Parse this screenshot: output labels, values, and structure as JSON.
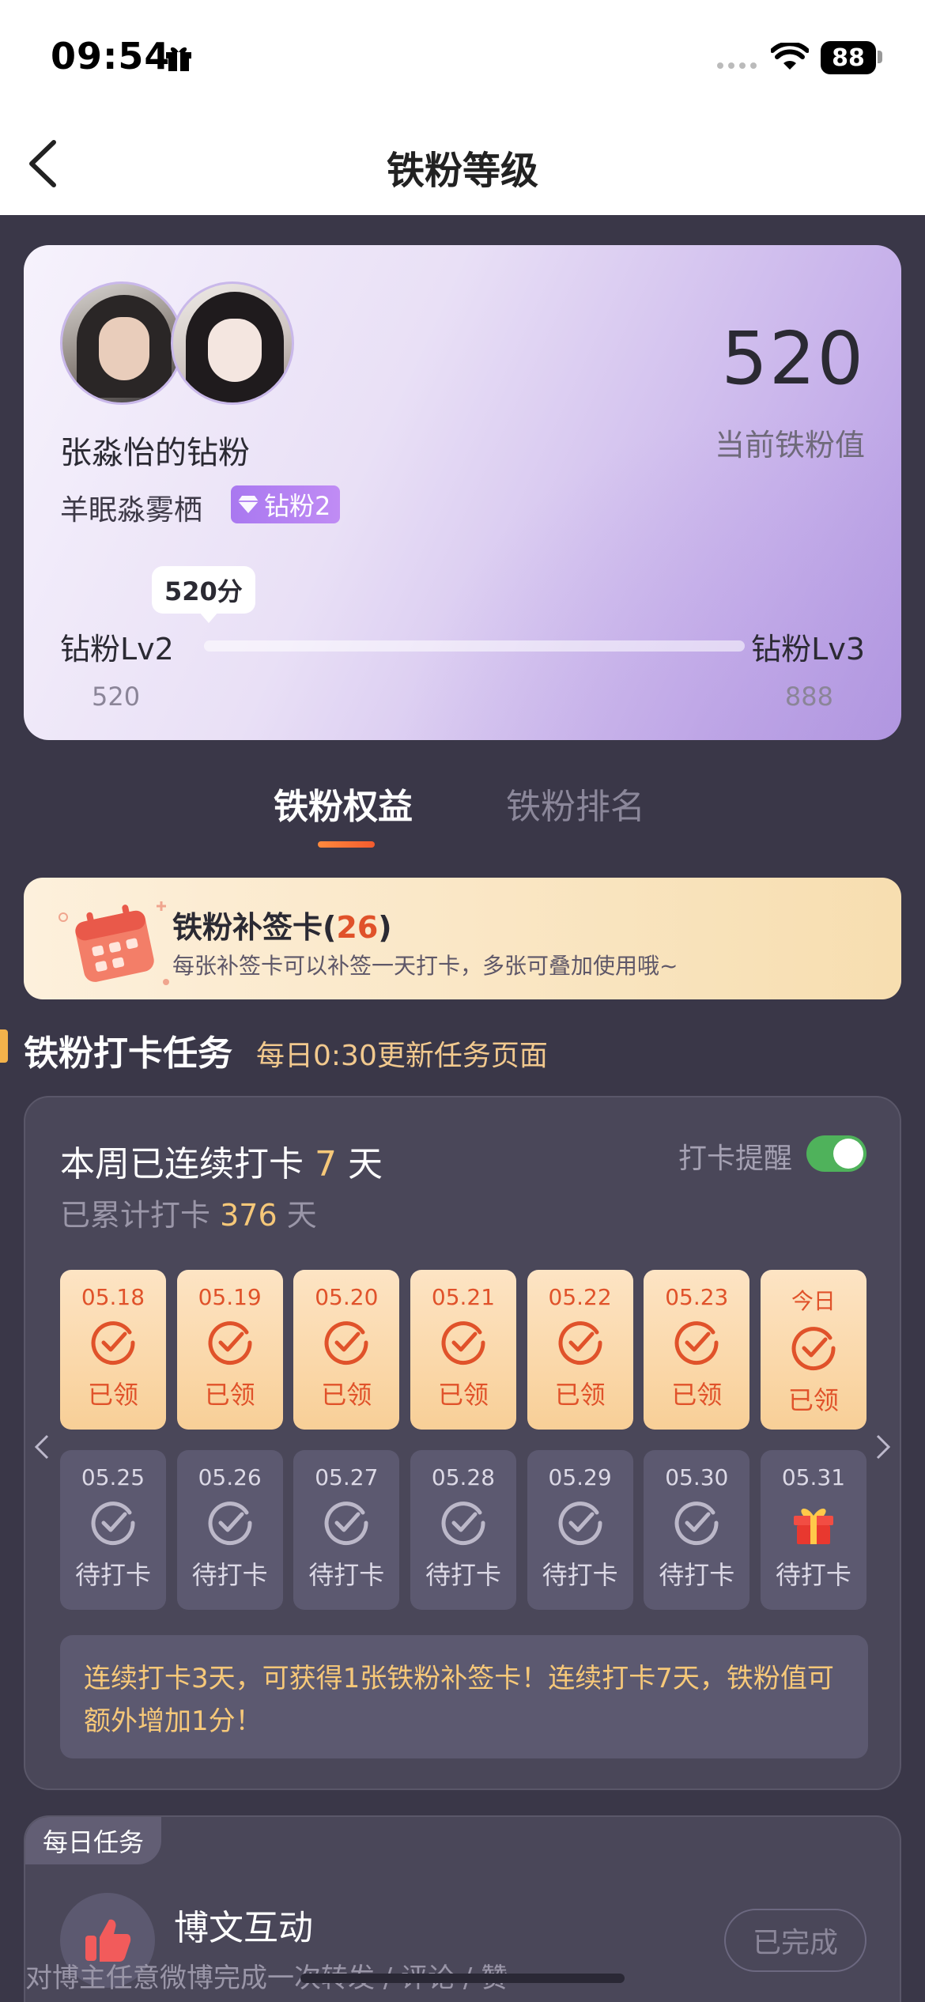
{
  "status_bar": {
    "time": "09:54",
    "battery": "88"
  },
  "nav": {
    "title": "铁粉等级"
  },
  "level_card": {
    "fan_title": "张淼怡的钻粉",
    "owner_name": "羊眠淼雾栖",
    "badge": "钻粉2",
    "score": "520",
    "score_label": "当前铁粉值",
    "bubble": "520分",
    "current_level": "钻粉Lv2",
    "current_level_value": "520",
    "next_level": "钻粉Lv3",
    "next_level_value": "888",
    "progress": 0
  },
  "tabs": [
    {
      "label": "铁粉权益",
      "active": true
    },
    {
      "label": "铁粉排名",
      "active": false
    }
  ],
  "makeup_card": {
    "title": "铁粉补签卡",
    "count": "26",
    "description": "每张补签卡可以补签一天打卡，多张可叠加使用哦~"
  },
  "checkin_section": {
    "title": "铁粉打卡任务",
    "subtitle": "每日0:30更新任务页面"
  },
  "checkin": {
    "streak_prefix": "本周已连续打卡",
    "streak_days": "7",
    "streak_suffix": "天",
    "total_prefix": "已累计打卡",
    "total_days": "376",
    "total_suffix": "天",
    "reminder_label": "打卡提醒",
    "reminder_on": true,
    "week1": [
      {
        "date": "05.18",
        "status": "已领"
      },
      {
        "date": "05.19",
        "status": "已领"
      },
      {
        "date": "05.20",
        "status": "已领"
      },
      {
        "date": "05.21",
        "status": "已领"
      },
      {
        "date": "05.22",
        "status": "已领"
      },
      {
        "date": "05.23",
        "status": "已领"
      },
      {
        "date": "今日",
        "status": "已领"
      }
    ],
    "week2": [
      {
        "date": "05.25",
        "status": "待打卡"
      },
      {
        "date": "05.26",
        "status": "待打卡"
      },
      {
        "date": "05.27",
        "status": "待打卡"
      },
      {
        "date": "05.28",
        "status": "待打卡"
      },
      {
        "date": "05.29",
        "status": "待打卡"
      },
      {
        "date": "05.30",
        "status": "待打卡"
      },
      {
        "date": "05.31",
        "status": "待打卡",
        "gift": true
      }
    ],
    "tip": "连续打卡3天，可获得1张铁粉补签卡！连续打卡7天，铁粉值可额外增加1分！"
  },
  "daily_task": {
    "tag": "每日任务",
    "title": "博文互动",
    "description": "对博主任意微博完成一次转发 / 评论 / 赞",
    "button": "已完成"
  },
  "colors": {
    "accent_orange": "#e0522a",
    "gold": "#f6c879",
    "toggle_green": "#4fb25b",
    "bg_dark": "#3a3748"
  }
}
